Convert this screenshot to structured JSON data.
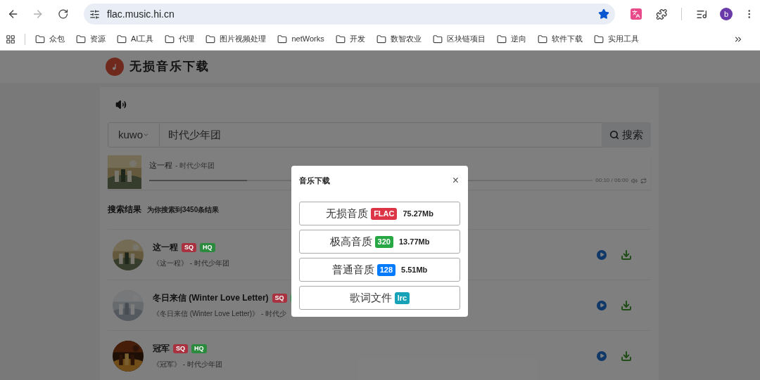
{
  "browser": {
    "url": "flac.music.hi.cn",
    "avatar": "b",
    "bookmarks": [
      "众包",
      "资源",
      "AI工具",
      "代理",
      "图片视频处理",
      "netWorks",
      "开发",
      "数智农业",
      "区块链项目",
      "逆向",
      "软件下载",
      "实用工具"
    ]
  },
  "site": {
    "title": "无损音乐下载"
  },
  "search": {
    "source": "kuwo",
    "query": "时代少年团",
    "button": "搜索"
  },
  "player": {
    "title": "这一程",
    "artist": "- 时代少年团",
    "time": "00:10 / 06:00",
    "level": 0.22
  },
  "results": {
    "title": "搜索结果",
    "count": "为你搜索到3450条结果",
    "songs": [
      {
        "title": "这一程",
        "badges": [
          {
            "text": "SQ",
            "color": "#a8323f"
          },
          {
            "text": "HQ",
            "color": "#2b8a3e"
          }
        ],
        "subtitle": "《这一程》 - 时代少年团"
      },
      {
        "title": "冬日来信 (Winter Love Letter)",
        "badges": [
          {
            "text": "SQ",
            "color": "#a8323f"
          },
          {
            "color": "#2b8a3e"
          }
        ],
        "subtitle": "《冬日来信 (Winter Love Letter)》 - 时代少"
      },
      {
        "title": "冠军",
        "badges": [
          {
            "text": "SQ",
            "color": "#a8323f"
          },
          {
            "text": "HQ",
            "color": "#2b8a3e"
          }
        ],
        "subtitle": "《冠军》 - 时代少年团"
      }
    ]
  },
  "modal": {
    "title": "音乐下载",
    "close": "×",
    "options": [
      {
        "label": "无损音质",
        "badge": {
          "text": "FLAC",
          "color": "#dc3545"
        },
        "size": "75.27Mb"
      },
      {
        "label": "极高音质",
        "badge": {
          "text": "320",
          "color": "#28a745"
        },
        "size": "13.77Mb"
      },
      {
        "label": "普通音质",
        "badge": {
          "text": "128",
          "color": "#007bff"
        },
        "size": "5.51Mb"
      },
      {
        "label": "歌词文件",
        "badge": {
          "text": "lrc",
          "color": "#17a2b8"
        }
      }
    ]
  }
}
